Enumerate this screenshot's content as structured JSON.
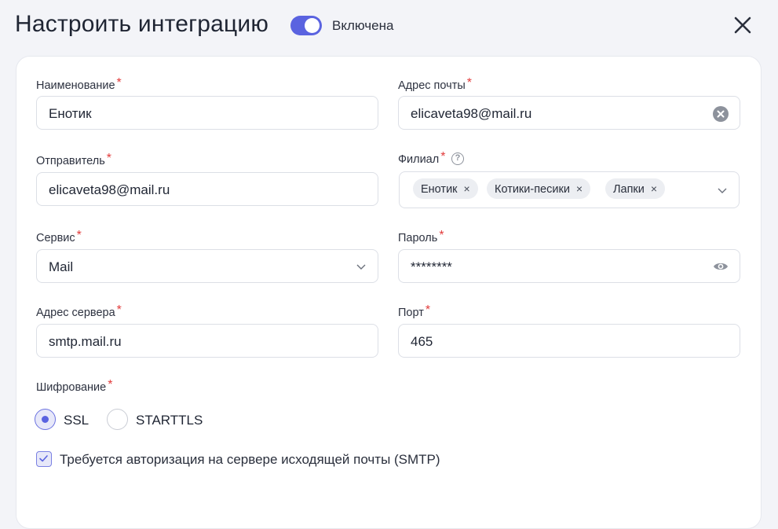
{
  "header": {
    "title": "Настроить интеграцию",
    "toggle_label": "Включена",
    "toggle_on": true
  },
  "colors": {
    "accent": "#5a63e0",
    "required": "#e23b3b"
  },
  "form": {
    "name": {
      "label": "Наименование",
      "required": "*",
      "value": "Енотик"
    },
    "email": {
      "label": "Адрес почты",
      "required": "*",
      "value": "elicaveta98@mail.ru",
      "icon": "clear-icon"
    },
    "sender": {
      "label": "Отправитель",
      "required": "*",
      "value": "elicaveta98@mail.ru"
    },
    "branch": {
      "label": "Филиал",
      "required": "*",
      "help": "?",
      "tags": [
        {
          "label": "Енотик",
          "remove": "×"
        },
        {
          "label": "Котики-песики",
          "remove": "×"
        },
        {
          "label": "Лапки",
          "remove": "×"
        }
      ],
      "icon": "chevron-down-icon"
    },
    "service": {
      "label": "Сервис",
      "required": "*",
      "value": "Mail",
      "icon": "chevron-down-icon"
    },
    "password": {
      "label": "Пароль",
      "required": "*",
      "value": "********",
      "icon": "eye-icon"
    },
    "server": {
      "label": "Адрес сервера",
      "required": "*",
      "value": "smtp.mail.ru"
    },
    "port": {
      "label": "Порт",
      "required": "*",
      "value": "465"
    },
    "encryption": {
      "label": "Шифрование",
      "required": "*",
      "options": [
        {
          "label": "SSL",
          "selected": true
        },
        {
          "label": "STARTTLS",
          "selected": false
        }
      ]
    },
    "auth": {
      "label": "Требуется авторизация на сервере исходящей почты (SMTP)",
      "checked": true
    }
  }
}
